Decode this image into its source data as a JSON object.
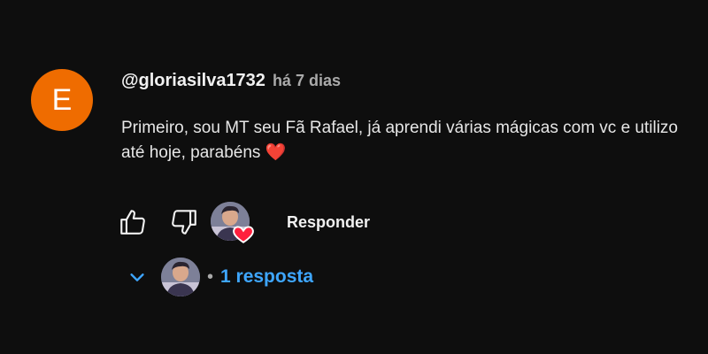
{
  "comment": {
    "avatar_letter": "E",
    "avatar_color": "#ef6c00",
    "username": "@gloriasilva1732",
    "time": "há 7 dias",
    "text": "Primeiro, sou MT seu Fã Rafael, já aprendi várias mágicas com vc e utilizo até hoje, parabéns ❤️"
  },
  "actions": {
    "like_icon": "thumbs-up-icon",
    "dislike_icon": "thumbs-down-icon",
    "creator_heart_icon": "heart-icon",
    "heart_color": "#ff1f3d",
    "reply_label": "Responder"
  },
  "replies": {
    "toggle_icon": "chevron-down-icon",
    "separator": "•",
    "count_label": "1 resposta",
    "accent_color": "#3ea6ff"
  }
}
